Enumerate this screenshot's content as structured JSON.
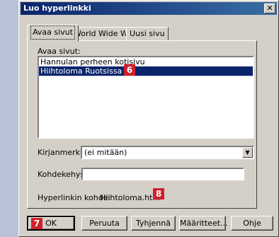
{
  "dialog": {
    "title": "Luo hyperlinkki",
    "close_glyph": "✕"
  },
  "tabs": [
    {
      "label": "Avaa sivut",
      "active": true
    },
    {
      "label": "World Wide Web",
      "active": false
    },
    {
      "label": "Uusi sivu",
      "active": false
    }
  ],
  "open_pages": {
    "label": "Avaa sivut:",
    "items": [
      {
        "label": "Hannulan perheen kotisivu",
        "selected": false
      },
      {
        "label": "Hiihtoloma Ruotsissa",
        "selected": true
      }
    ]
  },
  "bookmark": {
    "label": "Kirjanmerkki:",
    "value": "(ei mitään)"
  },
  "target_frame": {
    "label": "Kohdekehys:",
    "value": ""
  },
  "link_target": {
    "label": "Hyperlinkin kohde:",
    "value": "Hiihtoloma.htm"
  },
  "buttons": {
    "ok": "OK",
    "cancel": "Peruuta",
    "clear": "Tyhjennä",
    "properties": "Määritteet...",
    "help": "Ohje"
  },
  "markers": {
    "m6": "6",
    "m7": "7",
    "m8": "8"
  },
  "colors": {
    "title_start": "#0a246a",
    "title_end": "#3a6ea5",
    "selection": "#0a246a",
    "marker": "#d0202c",
    "face": "#d4d0c8"
  }
}
